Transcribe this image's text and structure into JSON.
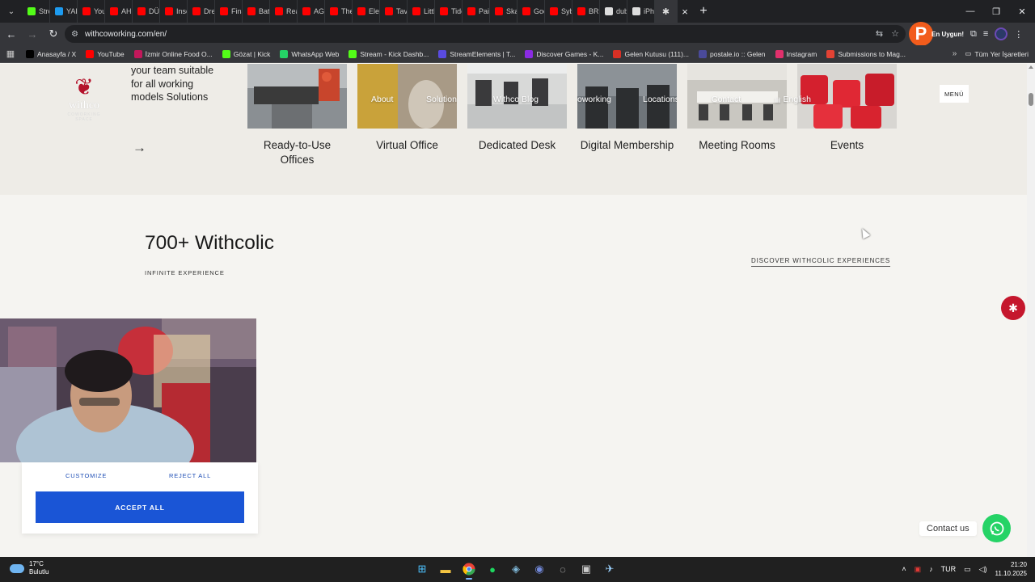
{
  "browser": {
    "tabs": [
      {
        "label": "Stre",
        "color": "#53fc18"
      },
      {
        "label": "YAP",
        "color": "#1d9bf0"
      },
      {
        "label": "You",
        "color": "#ff0000"
      },
      {
        "label": "AHL",
        "color": "#ff0000"
      },
      {
        "label": "DÜN",
        "color": "#ff0000"
      },
      {
        "label": "Inso",
        "color": "#ff0000"
      },
      {
        "label": "Dre",
        "color": "#ff0000"
      },
      {
        "label": "Fina",
        "color": "#ff0000"
      },
      {
        "label": "Batt",
        "color": "#ff0000"
      },
      {
        "label": "Rea",
        "color": "#ff0000"
      },
      {
        "label": "AGF",
        "color": "#ff0000"
      },
      {
        "label": "The",
        "color": "#ff0000"
      },
      {
        "label": "Elec",
        "color": "#ff0000"
      },
      {
        "label": "Tave",
        "color": "#ff0000"
      },
      {
        "label": "Littl",
        "color": "#ff0000"
      },
      {
        "label": "Tide",
        "color": "#ff0000"
      },
      {
        "label": "Pair",
        "color": "#ff0000"
      },
      {
        "label": "Skat",
        "color": "#ff0000"
      },
      {
        "label": "God",
        "color": "#ff0000"
      },
      {
        "label": "Sybi",
        "color": "#ff0000"
      },
      {
        "label": "BRE",
        "color": "#ff0000"
      },
      {
        "label": "dub",
        "color": "#dddddd"
      },
      {
        "label": "iPho",
        "color": "#dddddd"
      }
    ],
    "active_tab_icon": "witchco-icon",
    "new_tab": "+",
    "url": "withcoworking.com/en/",
    "profile_badge": "En Uygun!",
    "profile_letter": "P",
    "bookmarks": [
      {
        "label": "Anasayfa / X",
        "color": "#000000"
      },
      {
        "label": "YouTube",
        "color": "#ff0000"
      },
      {
        "label": "İzmir Online Food O...",
        "color": "#c2185b"
      },
      {
        "label": "Gözat | Kick",
        "color": "#53fc18"
      },
      {
        "label": "WhatsApp Web",
        "color": "#25d366"
      },
      {
        "label": "Stream - Kick Dashb...",
        "color": "#53fc18"
      },
      {
        "label": "StreamElements | T...",
        "color": "#5a4be0"
      },
      {
        "label": "Discover Games - K...",
        "color": "#8a2be2"
      },
      {
        "label": "Gelen Kutusu (111)...",
        "color": "#d93025"
      },
      {
        "label": "postale.io :: Gelen",
        "color": "#4a4a9a"
      },
      {
        "label": "Instagram",
        "color": "#e1306c"
      },
      {
        "label": "Submissions to Mag...",
        "color": "#e34234"
      }
    ],
    "bookmarks_folder": "Tüm Yer İşaretleri"
  },
  "site": {
    "logo_word": "withco",
    "logo_sub": "COWORKING SPACE",
    "intro": "your team suitable for all working models Solutions",
    "nav": [
      "About",
      "Solutions",
      "Withco Blog",
      "Coworking",
      "Locations",
      "Contact",
      "English"
    ],
    "menu_label": "MENÜ",
    "cards": [
      {
        "label": "Ready-to-Use Offices"
      },
      {
        "label": "Virtual Office"
      },
      {
        "label": "Dedicated Desk"
      },
      {
        "label": "Digital Membership"
      },
      {
        "label": "Meeting Rooms"
      },
      {
        "label": "Events"
      }
    ],
    "stats_title": "700+ Withcolic",
    "stats_subtitle": "INFINITE EXPERIENCE",
    "discover_link": "DISCOVER WITHCOLIC EXPERIENCES",
    "cookie": {
      "customize": "CUSTOMIZE",
      "reject": "REJECT ALL",
      "accept": "ACCEPT ALL"
    },
    "contact_label": "Contact us"
  },
  "taskbar": {
    "temperature": "17°C",
    "weather": "Bulutlu",
    "language": "TUR",
    "time": "21:20",
    "date": "11.10.2025"
  }
}
